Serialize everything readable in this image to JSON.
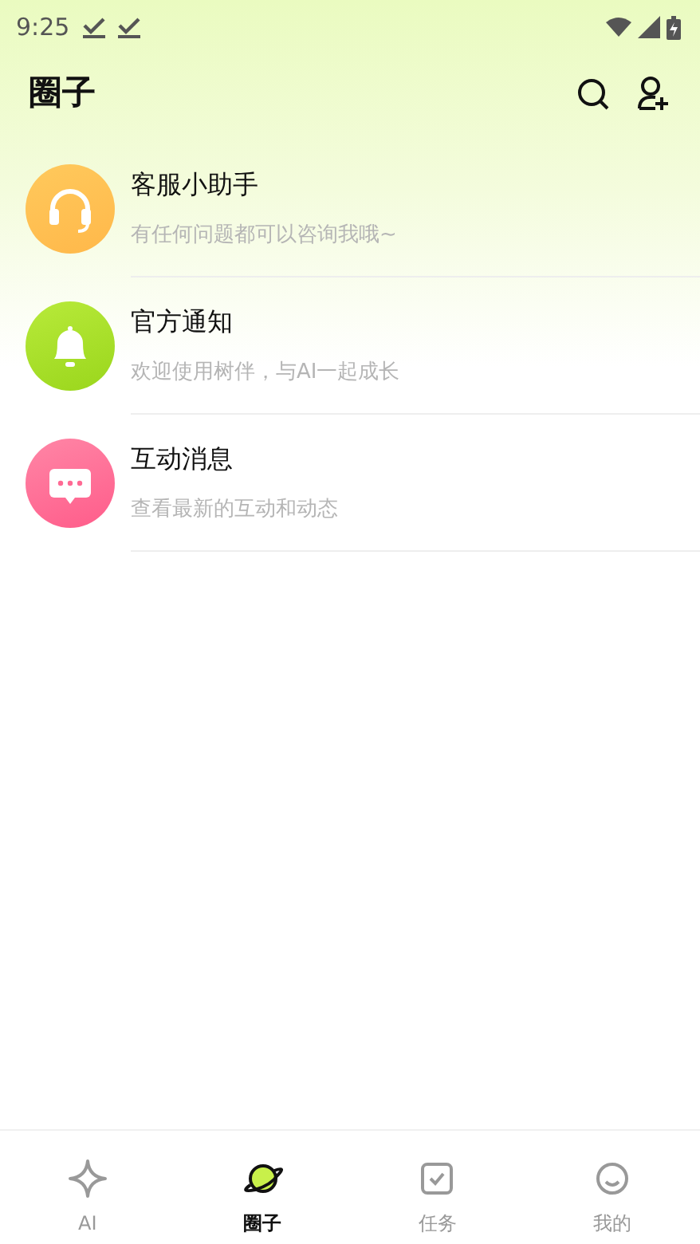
{
  "status_bar": {
    "time": "9:25"
  },
  "header": {
    "title": "圈子"
  },
  "conversations": [
    {
      "kind": "support",
      "name": "客服小助手",
      "preview": "有任何问题都可以咨询我哦~"
    },
    {
      "kind": "notice",
      "name": "官方通知",
      "preview": "欢迎使用树伴，与AI一起成长"
    },
    {
      "kind": "interaction",
      "name": "互动消息",
      "preview": "查看最新的互动和动态"
    }
  ],
  "tab_bar": [
    {
      "kind": "ai",
      "label": "AI",
      "selected": false
    },
    {
      "kind": "circle",
      "label": "圈子",
      "selected": true
    },
    {
      "kind": "task",
      "label": "任务",
      "selected": false
    },
    {
      "kind": "me",
      "label": "我的",
      "selected": false
    }
  ]
}
